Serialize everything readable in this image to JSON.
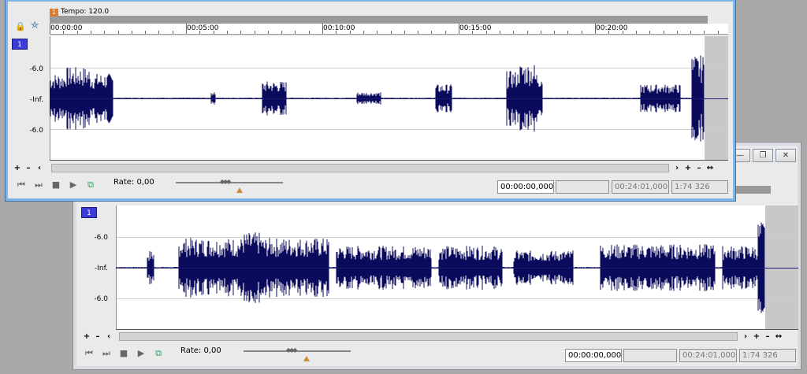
{
  "front_window": {
    "track_number": "1",
    "tempo_marker": "1",
    "tempo_label": "Tempo: 120.0",
    "ruler_labels": [
      "00:00:00",
      "00:05:00",
      "00:10:00",
      "00:15:00",
      "00:20:00"
    ],
    "db_labels": [
      "-6.0",
      "-Inf.",
      "-6.0"
    ],
    "rate_label": "Rate: 0,00",
    "timecode_current": "00:00:00,000",
    "timecode_blank": "",
    "timecode_length": "00:24:01,000",
    "zoom_ratio": "1:74 326"
  },
  "back_window": {
    "track_number": "1",
    "db_labels": [
      "-6.0",
      "-Inf.",
      "-6.0"
    ],
    "rate_label": "Rate: 0,00",
    "timecode_current": "00:00:00,000",
    "timecode_blank": "",
    "timecode_length": "00:24:01,000",
    "zoom_ratio": "1:74 326"
  },
  "icons": {
    "lock": "lock-icon",
    "snap": "snap-icon",
    "go_start": "go-to-start-icon",
    "go_end": "go-to-end-icon",
    "stop": "stop-icon",
    "play": "play-icon",
    "loop": "loop-icon",
    "zoom_in": "zoom-in-icon",
    "zoom_out": "zoom-out-icon",
    "scroll_left": "scroll-left-icon",
    "scroll_right": "scroll-right-icon",
    "minimize": "minimize-icon",
    "restore": "restore-icon",
    "close": "close-icon"
  },
  "colors": {
    "waveform": "#0b0b5e",
    "tempo_marker": "#e07a2a",
    "track_number_bg": "#3b3bd6"
  }
}
